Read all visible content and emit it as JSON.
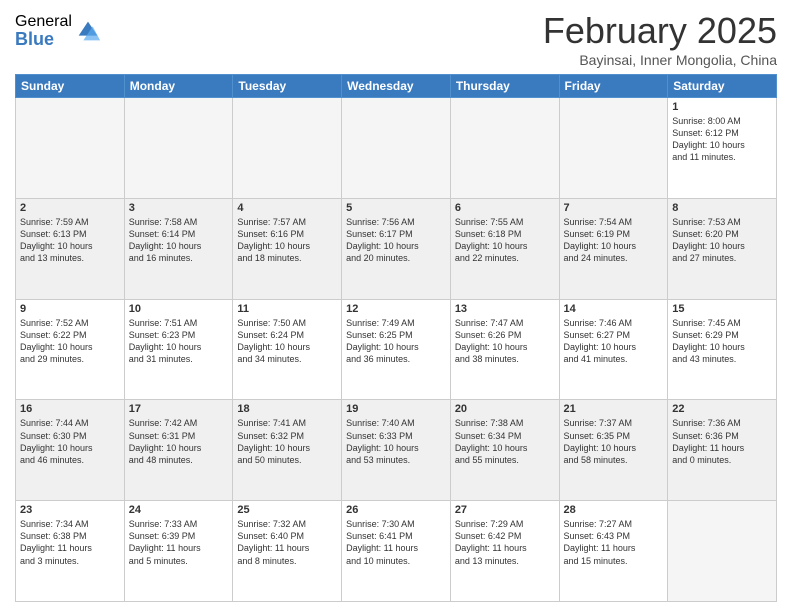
{
  "header": {
    "logo_general": "General",
    "logo_blue": "Blue",
    "month_title": "February 2025",
    "location": "Bayinsai, Inner Mongolia, China"
  },
  "days_of_week": [
    "Sunday",
    "Monday",
    "Tuesday",
    "Wednesday",
    "Thursday",
    "Friday",
    "Saturday"
  ],
  "weeks": [
    [
      {
        "day": "",
        "info": ""
      },
      {
        "day": "",
        "info": ""
      },
      {
        "day": "",
        "info": ""
      },
      {
        "day": "",
        "info": ""
      },
      {
        "day": "",
        "info": ""
      },
      {
        "day": "",
        "info": ""
      },
      {
        "day": "1",
        "info": "Sunrise: 8:00 AM\nSunset: 6:12 PM\nDaylight: 10 hours\nand 11 minutes."
      }
    ],
    [
      {
        "day": "2",
        "info": "Sunrise: 7:59 AM\nSunset: 6:13 PM\nDaylight: 10 hours\nand 13 minutes."
      },
      {
        "day": "3",
        "info": "Sunrise: 7:58 AM\nSunset: 6:14 PM\nDaylight: 10 hours\nand 16 minutes."
      },
      {
        "day": "4",
        "info": "Sunrise: 7:57 AM\nSunset: 6:16 PM\nDaylight: 10 hours\nand 18 minutes."
      },
      {
        "day": "5",
        "info": "Sunrise: 7:56 AM\nSunset: 6:17 PM\nDaylight: 10 hours\nand 20 minutes."
      },
      {
        "day": "6",
        "info": "Sunrise: 7:55 AM\nSunset: 6:18 PM\nDaylight: 10 hours\nand 22 minutes."
      },
      {
        "day": "7",
        "info": "Sunrise: 7:54 AM\nSunset: 6:19 PM\nDaylight: 10 hours\nand 24 minutes."
      },
      {
        "day": "8",
        "info": "Sunrise: 7:53 AM\nSunset: 6:20 PM\nDaylight: 10 hours\nand 27 minutes."
      }
    ],
    [
      {
        "day": "9",
        "info": "Sunrise: 7:52 AM\nSunset: 6:22 PM\nDaylight: 10 hours\nand 29 minutes."
      },
      {
        "day": "10",
        "info": "Sunrise: 7:51 AM\nSunset: 6:23 PM\nDaylight: 10 hours\nand 31 minutes."
      },
      {
        "day": "11",
        "info": "Sunrise: 7:50 AM\nSunset: 6:24 PM\nDaylight: 10 hours\nand 34 minutes."
      },
      {
        "day": "12",
        "info": "Sunrise: 7:49 AM\nSunset: 6:25 PM\nDaylight: 10 hours\nand 36 minutes."
      },
      {
        "day": "13",
        "info": "Sunrise: 7:47 AM\nSunset: 6:26 PM\nDaylight: 10 hours\nand 38 minutes."
      },
      {
        "day": "14",
        "info": "Sunrise: 7:46 AM\nSunset: 6:27 PM\nDaylight: 10 hours\nand 41 minutes."
      },
      {
        "day": "15",
        "info": "Sunrise: 7:45 AM\nSunset: 6:29 PM\nDaylight: 10 hours\nand 43 minutes."
      }
    ],
    [
      {
        "day": "16",
        "info": "Sunrise: 7:44 AM\nSunset: 6:30 PM\nDaylight: 10 hours\nand 46 minutes."
      },
      {
        "day": "17",
        "info": "Sunrise: 7:42 AM\nSunset: 6:31 PM\nDaylight: 10 hours\nand 48 minutes."
      },
      {
        "day": "18",
        "info": "Sunrise: 7:41 AM\nSunset: 6:32 PM\nDaylight: 10 hours\nand 50 minutes."
      },
      {
        "day": "19",
        "info": "Sunrise: 7:40 AM\nSunset: 6:33 PM\nDaylight: 10 hours\nand 53 minutes."
      },
      {
        "day": "20",
        "info": "Sunrise: 7:38 AM\nSunset: 6:34 PM\nDaylight: 10 hours\nand 55 minutes."
      },
      {
        "day": "21",
        "info": "Sunrise: 7:37 AM\nSunset: 6:35 PM\nDaylight: 10 hours\nand 58 minutes."
      },
      {
        "day": "22",
        "info": "Sunrise: 7:36 AM\nSunset: 6:36 PM\nDaylight: 11 hours\nand 0 minutes."
      }
    ],
    [
      {
        "day": "23",
        "info": "Sunrise: 7:34 AM\nSunset: 6:38 PM\nDaylight: 11 hours\nand 3 minutes."
      },
      {
        "day": "24",
        "info": "Sunrise: 7:33 AM\nSunset: 6:39 PM\nDaylight: 11 hours\nand 5 minutes."
      },
      {
        "day": "25",
        "info": "Sunrise: 7:32 AM\nSunset: 6:40 PM\nDaylight: 11 hours\nand 8 minutes."
      },
      {
        "day": "26",
        "info": "Sunrise: 7:30 AM\nSunset: 6:41 PM\nDaylight: 11 hours\nand 10 minutes."
      },
      {
        "day": "27",
        "info": "Sunrise: 7:29 AM\nSunset: 6:42 PM\nDaylight: 11 hours\nand 13 minutes."
      },
      {
        "day": "28",
        "info": "Sunrise: 7:27 AM\nSunset: 6:43 PM\nDaylight: 11 hours\nand 15 minutes."
      },
      {
        "day": "",
        "info": ""
      }
    ]
  ]
}
